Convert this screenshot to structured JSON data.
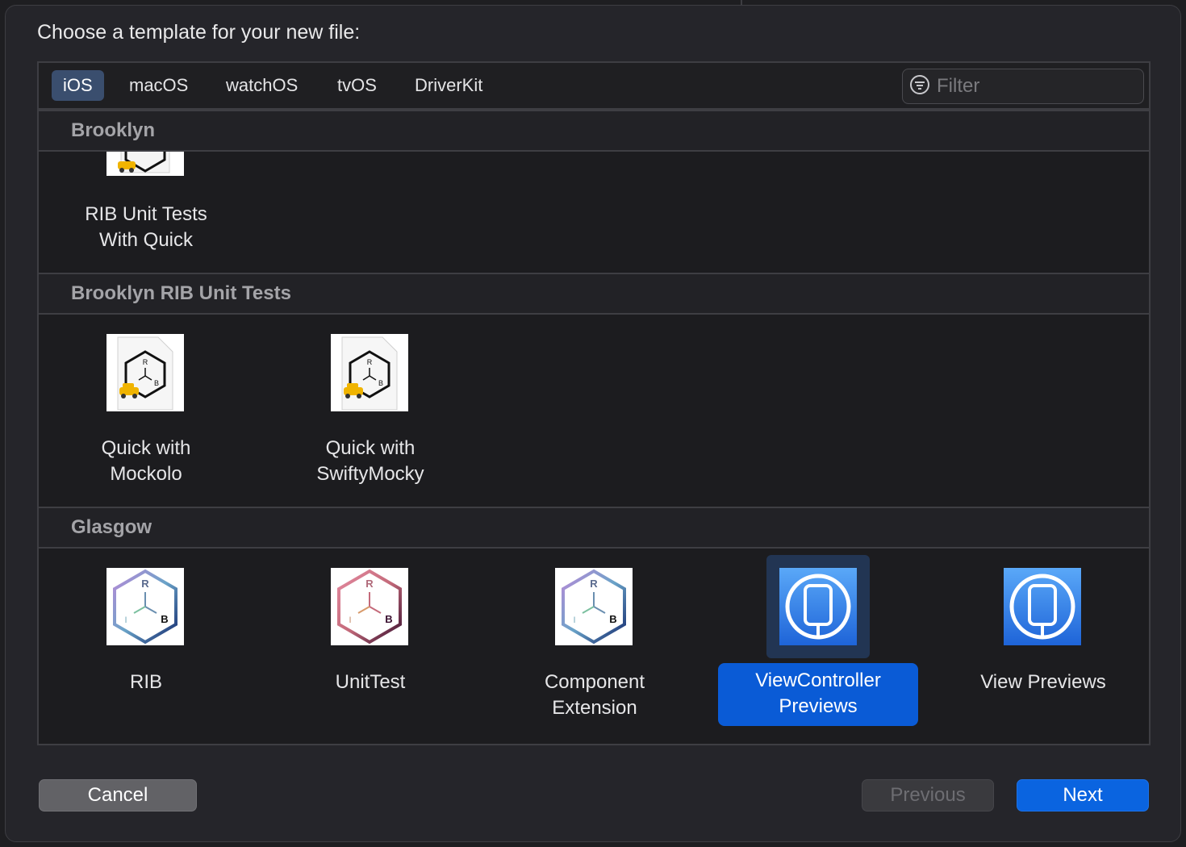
{
  "dialog": {
    "prompt": "Choose a template for your new file:"
  },
  "tabs": [
    {
      "label": "iOS",
      "selected": true
    },
    {
      "label": "macOS",
      "selected": false
    },
    {
      "label": "watchOS",
      "selected": false
    },
    {
      "label": "tvOS",
      "selected": false
    },
    {
      "label": "DriverKit",
      "selected": false
    }
  ],
  "filter": {
    "placeholder": "Filter",
    "value": ""
  },
  "sections": [
    {
      "title": "Brooklyn",
      "items": [
        {
          "label_line1": "RIB Unit Tests",
          "label_line2": "With Quick",
          "icon": "rib-taxi-file-icon"
        }
      ]
    },
    {
      "title": "Brooklyn RIB Unit Tests",
      "items": [
        {
          "label_line1": "Quick with",
          "label_line2": "Mockolo",
          "icon": "rib-taxi-file-icon"
        },
        {
          "label_line1": "Quick with",
          "label_line2": "SwiftyMocky",
          "icon": "rib-taxi-file-icon"
        }
      ]
    },
    {
      "title": "Glasgow",
      "items": [
        {
          "label_line1": "RIB",
          "label_line2": "",
          "icon": "rib-hexagon-icon"
        },
        {
          "label_line1": "UnitTest",
          "label_line2": "",
          "icon": "rib-hexagon-pink-icon"
        },
        {
          "label_line1": "Component",
          "label_line2": "Extension",
          "icon": "rib-hexagon-icon"
        },
        {
          "label_line1": "ViewController",
          "label_line2": "Previews",
          "icon": "device-preview-icon",
          "selected": true
        },
        {
          "label_line1": "View Previews",
          "label_line2": "",
          "icon": "device-preview-icon"
        }
      ]
    }
  ],
  "buttons": {
    "cancel": "Cancel",
    "previous": "Previous",
    "next": "Next"
  },
  "colors": {
    "accent": "#0a5bd6",
    "next_button": "#0a64e0",
    "tab_selected": "#3a4e6e"
  }
}
